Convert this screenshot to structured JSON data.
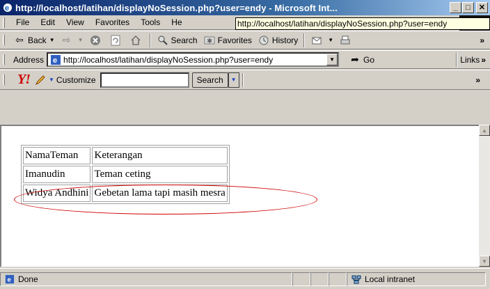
{
  "window": {
    "title": "http://localhost/latihan/displayNoSession.php?user=endy - Microsoft Int...",
    "minimize": "_",
    "maximize": "□",
    "close": "✕"
  },
  "menu": {
    "items": [
      "File",
      "Edit",
      "View",
      "Favorites",
      "Tools",
      "He"
    ],
    "tooltip": "http://localhost/latihan/displayNoSession.php?user=endy"
  },
  "toolbar": {
    "back": "Back",
    "search": "Search",
    "favorites": "Favorites",
    "history": "History",
    "more": "»"
  },
  "address": {
    "label": "Address",
    "url": "http://localhost/latihan/displayNoSession.php?user=endy",
    "go": "Go",
    "links": "Links",
    "links_more": "»"
  },
  "yahoo": {
    "logo": "Y!",
    "customize": "Customize",
    "search_value": "",
    "search_button": "Search",
    "more": "»"
  },
  "page": {
    "table": [
      [
        "NamaTeman",
        "Keterangan"
      ],
      [
        "Imanudin",
        "Teman ceting"
      ],
      [
        "Widya Andhini",
        "Gebetan lama tapi masih mesra"
      ]
    ]
  },
  "status": {
    "text": "Done",
    "zone": "Local intranet"
  },
  "colors": {
    "title_gradient_start": "#0a246a",
    "title_gradient_end": "#a6caf0",
    "annotation_ellipse": "#d00000",
    "yahoo_red": "#cc0000"
  }
}
